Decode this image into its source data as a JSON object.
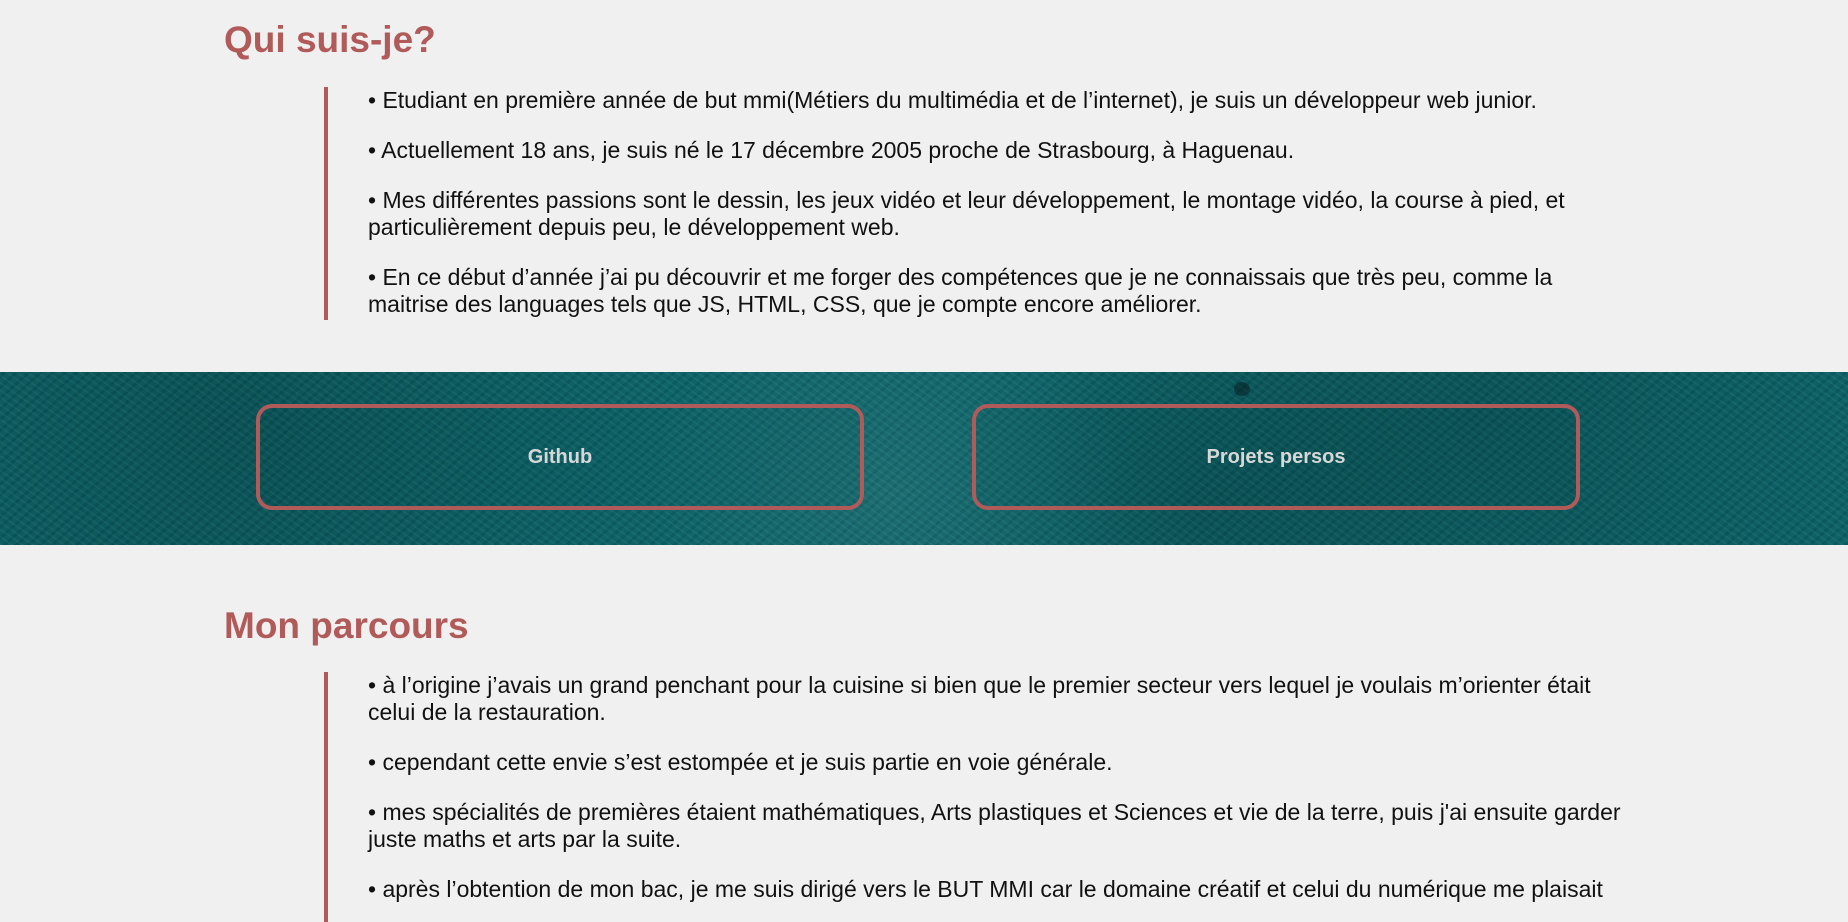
{
  "about": {
    "title": "Qui suis-je?",
    "items": [
      "• Etudiant en première année de but mmi(Métiers du multimédia et de l’internet), je suis un développeur web junior.",
      "• Actuellement 18 ans, je suis né le 17 décembre 2005 proche de Strasbourg, à Haguenau.",
      "• Mes différentes passions sont le dessin, les jeux vidéo et leur développement, le montage vidéo, la course à pied, et particulièrement depuis peu, le développement web.",
      "• En ce début d’année j’ai pu découvrir et me forger des compétences que je ne connaissais que très peu, comme la maitrise des languages tels que JS, HTML, CSS, que je compte encore améliorer."
    ]
  },
  "links": {
    "github_label": "Github",
    "projects_label": "Projets persos"
  },
  "journey": {
    "title": "Mon parcours",
    "items": [
      "• à l’origine j’avais un grand penchant pour la cuisine si bien que le premier secteur vers lequel je voulais m’orienter était celui de la restauration.",
      "• cependant cette envie s’est estompée et je suis partie en voie générale.",
      "• mes spécialités de premières étaient mathématiques, Arts plastiques et Sciences et vie de la terre, puis j'ai ensuite garder juste maths et arts par la suite.",
      "• après l’obtention de mon bac, je me suis dirigé vers le BUT MMI car le domaine créatif et celui du numérique me plaisait"
    ]
  },
  "colors": {
    "accent": "#b15a5a",
    "band": "#0a6469",
    "page_background": "#f0f0f0"
  }
}
